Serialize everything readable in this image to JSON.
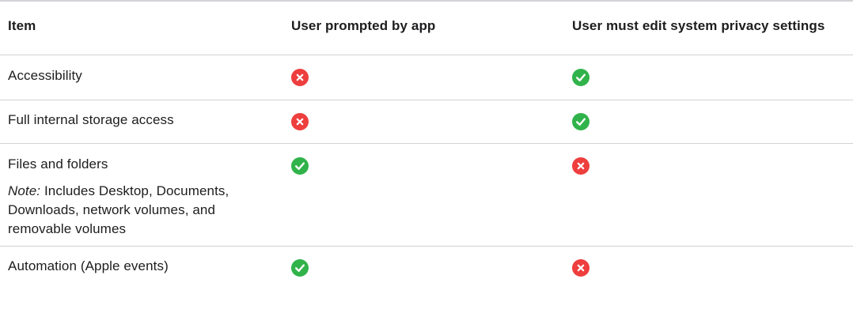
{
  "table": {
    "headers": {
      "item": "Item",
      "prompted": "User prompted by app",
      "system": "User must edit system privacy settings"
    },
    "rows": [
      {
        "item": "Accessibility",
        "prompted": "no",
        "system": "yes"
      },
      {
        "item": "Full internal storage access",
        "prompted": "no",
        "system": "yes"
      },
      {
        "item": "Files and folders",
        "note_label": "Note:",
        "note_text": " Includes Desktop, Documents, Downloads, network volumes, and removable volumes",
        "prompted": "yes",
        "system": "no"
      },
      {
        "item": "Automation (Apple events)",
        "prompted": "yes",
        "system": "no"
      }
    ]
  },
  "icons": {
    "yes": "green-checkmark-icon",
    "no": "red-x-icon"
  },
  "colors": {
    "yes": "#30b34a",
    "no": "#ee3e3e",
    "border": "#d2d2d7",
    "text": "#1d1d1f"
  }
}
